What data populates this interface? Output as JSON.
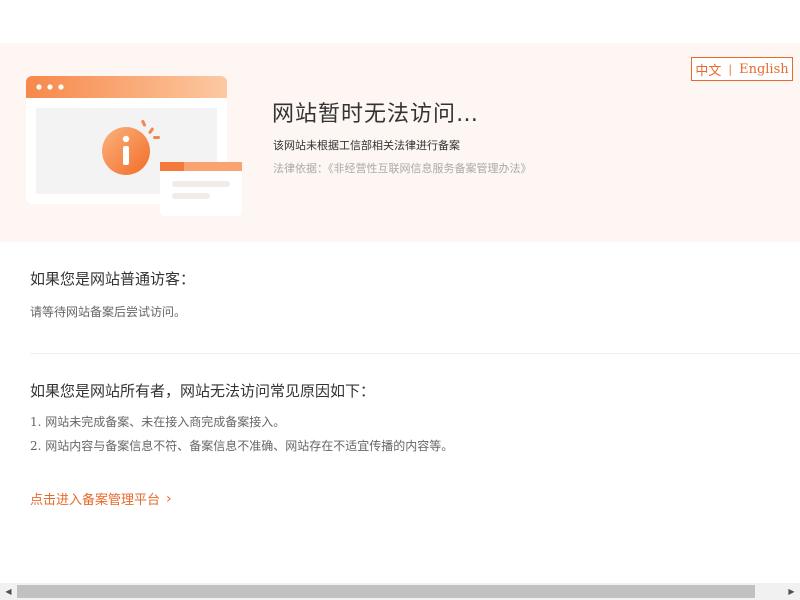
{
  "lang_switch": {
    "zh": "中文",
    "separator": "|",
    "en": "English"
  },
  "hero": {
    "title": "网站暂时无法访问…",
    "subtitle": "该网站未根据工信部相关法律进行备案",
    "law": "法律依据：《非经营性互联网信息服务备案管理办法》",
    "illustration_icon": "info-icon"
  },
  "visitor": {
    "heading": "如果您是网站普通访客：",
    "text": "请等待网站备案后尝试访问。"
  },
  "owner": {
    "heading": "如果您是网站所有者，网站无法访问常见原因如下：",
    "reasons": [
      {
        "num": "1.",
        "text": "网站未完成备案、未在接入商完成备案接入。"
      },
      {
        "num": "2.",
        "text": "网站内容与备案信息不符、备案信息不准确、网站存在不适宜传播的内容等。"
      }
    ]
  },
  "link": {
    "label": "点击进入备案管理平台",
    "chevron": "›"
  },
  "scrollbar": {
    "left_arrow": "◀",
    "right_arrow": "▶"
  },
  "colors": {
    "accent": "#e9692c",
    "hero_bg": "#fdf6f2"
  }
}
